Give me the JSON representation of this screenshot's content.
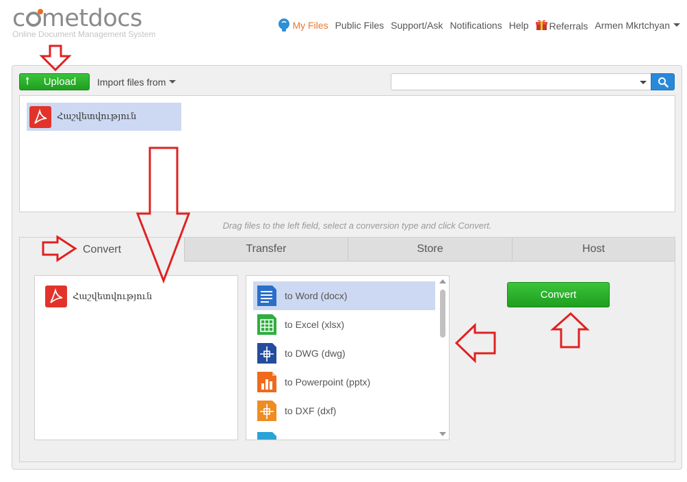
{
  "logo": {
    "pre": "c",
    "post": "metdocs",
    "tagline": "Online Document Management System"
  },
  "topnav": {
    "my_files": "My Files",
    "public_files": "Public Files",
    "support": "Support/Ask",
    "notifications": "Notifications",
    "help": "Help",
    "referrals": "Referrals",
    "user": "Armen Mkrtchyan"
  },
  "toolbar": {
    "upload_label": "Upload",
    "import_label": "Import files from",
    "search_value": ""
  },
  "files": [
    {
      "name": "Հաշվետվություն",
      "icon": "pdf-icon"
    }
  ],
  "hint": "Drag files to the left field, select a conversion type and click Convert.",
  "tabs": [
    {
      "label": "Convert",
      "active": true
    },
    {
      "label": "Transfer",
      "active": false
    },
    {
      "label": "Store",
      "active": false
    },
    {
      "label": "Host",
      "active": false
    }
  ],
  "selected_files": [
    {
      "name": "Հաշվետվություն",
      "icon": "pdf-icon"
    }
  ],
  "conversion_options": [
    {
      "label": "to Word (docx)",
      "icon": "word-icon",
      "selected": true
    },
    {
      "label": "to Excel (xlsx)",
      "icon": "excel-icon",
      "selected": false
    },
    {
      "label": "to DWG (dwg)",
      "icon": "dwg-icon",
      "selected": false
    },
    {
      "label": "to Powerpoint (pptx)",
      "icon": "powerpoint-icon",
      "selected": false
    },
    {
      "label": "to DXF (dxf)",
      "icon": "dxf-icon",
      "selected": false
    }
  ],
  "convert_label": "Convert",
  "colors": {
    "accent_green": "#22a722",
    "nav_active": "#e8782a",
    "selection": "#cdd9f2",
    "search_blue": "#2989d8",
    "annotation_red": "#e02020"
  }
}
